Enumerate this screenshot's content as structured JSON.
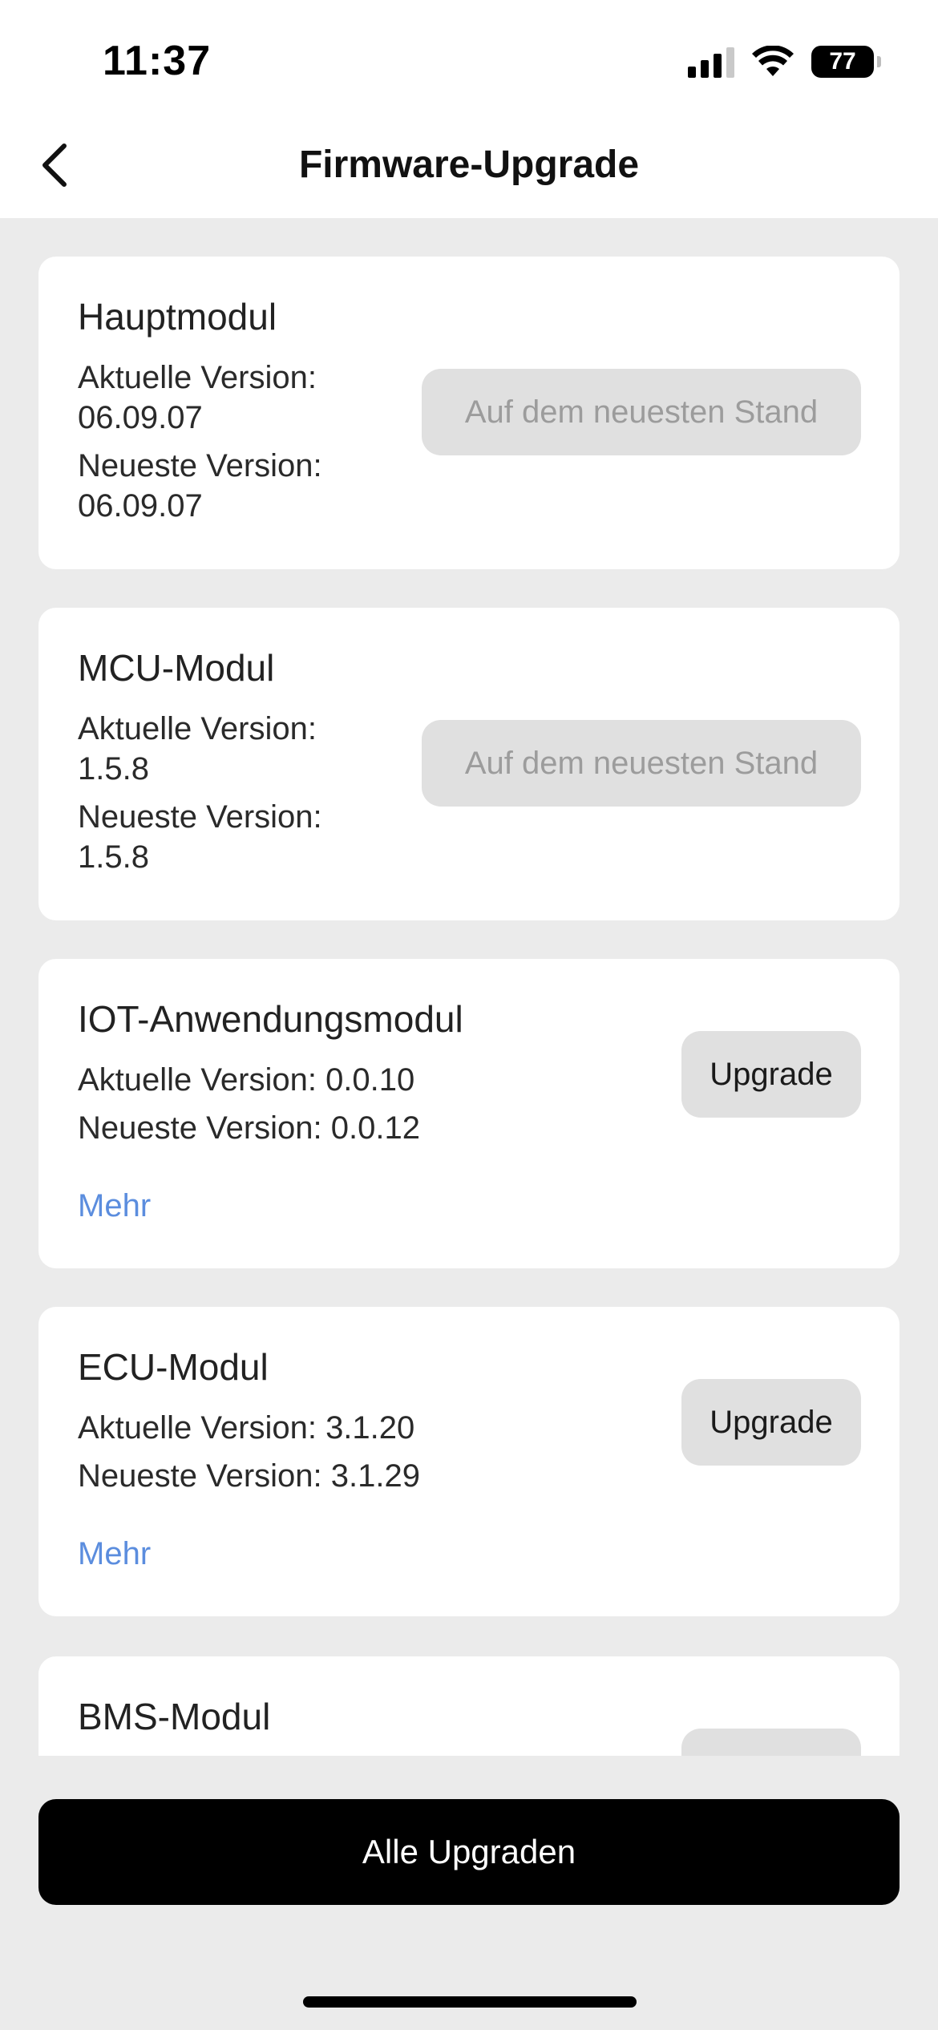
{
  "status_bar": {
    "time": "11:37",
    "battery": "77",
    "icons": [
      "cellular-signal-icon",
      "wifi-icon",
      "battery-icon"
    ]
  },
  "header": {
    "title": "Firmware-Upgrade",
    "back_icon": "chevron-left-icon"
  },
  "modules": [
    {
      "name": "Hauptmodul",
      "current_label": "Aktuelle Version:",
      "current_version": "06.09.07",
      "latest_label": "Neueste Version:",
      "latest_version": "06.09.07",
      "button": "Auf dem neuesten Stand"
    },
    {
      "name": "MCU-Modul",
      "current_label": "Aktuelle Version:",
      "current_version": "1.5.8",
      "latest_label": "Neueste Version:",
      "latest_version": "1.5.8",
      "button": "Auf dem neuesten Stand"
    },
    {
      "name": "IOT-Anwendungsmodul",
      "current_line": "Aktuelle Version: 0.0.10",
      "latest_line": "Neueste Version: 0.0.12",
      "button": "Upgrade",
      "more": "Mehr"
    },
    {
      "name": "ECU-Modul",
      "current_line": "Aktuelle Version: 3.1.20",
      "latest_line": "Neueste Version: 3.1.29",
      "button": "Upgrade",
      "more": "Mehr"
    },
    {
      "name": "BMS-Modul"
    }
  ],
  "footer": {
    "upgrade_all": "Alle Upgraden"
  },
  "colors": {
    "background": "#ebebeb",
    "card": "#ffffff",
    "link": "#5b8dde",
    "primary_button": "#000000",
    "pill": "#e0e0e0"
  }
}
